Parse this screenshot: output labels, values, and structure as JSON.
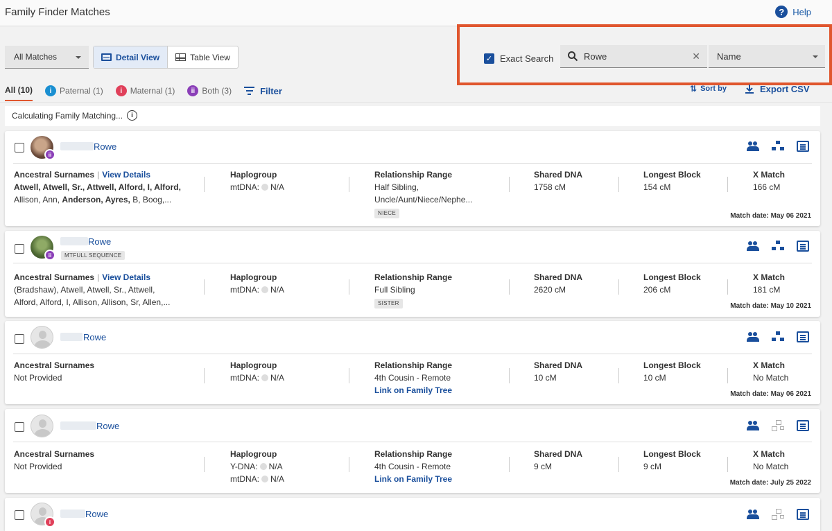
{
  "header": {
    "title": "Family Finder Matches",
    "help_label": "Help"
  },
  "controls": {
    "match_filter": "All Matches",
    "detail_view_label": "Detail View",
    "table_view_label": "Table View",
    "exact_search_label": "Exact Search",
    "exact_search_checked": true,
    "search_value": "Rowe",
    "search_field": "Name"
  },
  "tabs": [
    {
      "label": "All (10)",
      "active": true
    },
    {
      "label": "Paternal (1)"
    },
    {
      "label": "Maternal (1)"
    },
    {
      "label": "Both (3)"
    }
  ],
  "filter_label": "Filter",
  "sort_label": "Sort by",
  "export_label": "Export CSV",
  "calculating_text": "Calculating Family Matching...",
  "labels": {
    "ancestral_surnames": "Ancestral Surnames",
    "view_details": "View Details",
    "haplogroup": "Haplogroup",
    "relationship_range": "Relationship Range",
    "shared_dna": "Shared DNA",
    "longest_block": "Longest Block",
    "x_match": "X Match"
  },
  "matches": [
    {
      "name": "Rowe",
      "surnames_bold": "Atwell, Atwell, Sr., Attwell, Alford, I, Alford,",
      "surnames_rest": "Allison, Ann, Anderson, Ayres, B, Boog,...",
      "surnames_rest_bold": "Anderson, Ayres,",
      "hap1": "mtDNA:",
      "hap1_val": "N/A",
      "relationship": "Half Sibling,",
      "relationship2": "Uncle/Aunt/Niece/Nephe...",
      "rel_tag": "NIECE",
      "shared": "1758 cM",
      "longest": "154 cM",
      "xmatch": "166 cM",
      "date": "Match date: May 06 2021"
    },
    {
      "name": "Rowe",
      "tag": "MTFULL SEQUENCE",
      "surnames_l1": "(Bradshaw), Atwell, Atwell, Sr., Attwell,",
      "surnames_l2": "Alford, Alford, I, Allison, Allison, Sr, Allen,...",
      "hap1": "mtDNA:",
      "hap1_val": "N/A",
      "relationship": "Full Sibling",
      "rel_tag": "SISTER",
      "shared": "2620 cM",
      "longest": "206 cM",
      "xmatch": "181 cM",
      "date": "Match date: May 10 2021"
    },
    {
      "name": "Rowe",
      "surnames": "Not Provided",
      "hap1": "mtDNA:",
      "hap1_val": "N/A",
      "relationship": "4th Cousin - Remote",
      "link": "Link on Family Tree",
      "shared": "10 cM",
      "longest": "10 cM",
      "xmatch": "No Match",
      "date": "Match date: May 06 2021"
    },
    {
      "name": "Rowe",
      "surnames": "Not Provided",
      "hap1": "Y-DNA:",
      "hap1_val": "N/A",
      "hap2": "mtDNA:",
      "hap2_val": "N/A",
      "relationship": "4th Cousin - Remote",
      "link": "Link on Family Tree",
      "shared": "9 cM",
      "longest": "9 cM",
      "xmatch": "No Match",
      "date": "Match date: July 25 2022"
    },
    {
      "name": "Rowe"
    }
  ]
}
